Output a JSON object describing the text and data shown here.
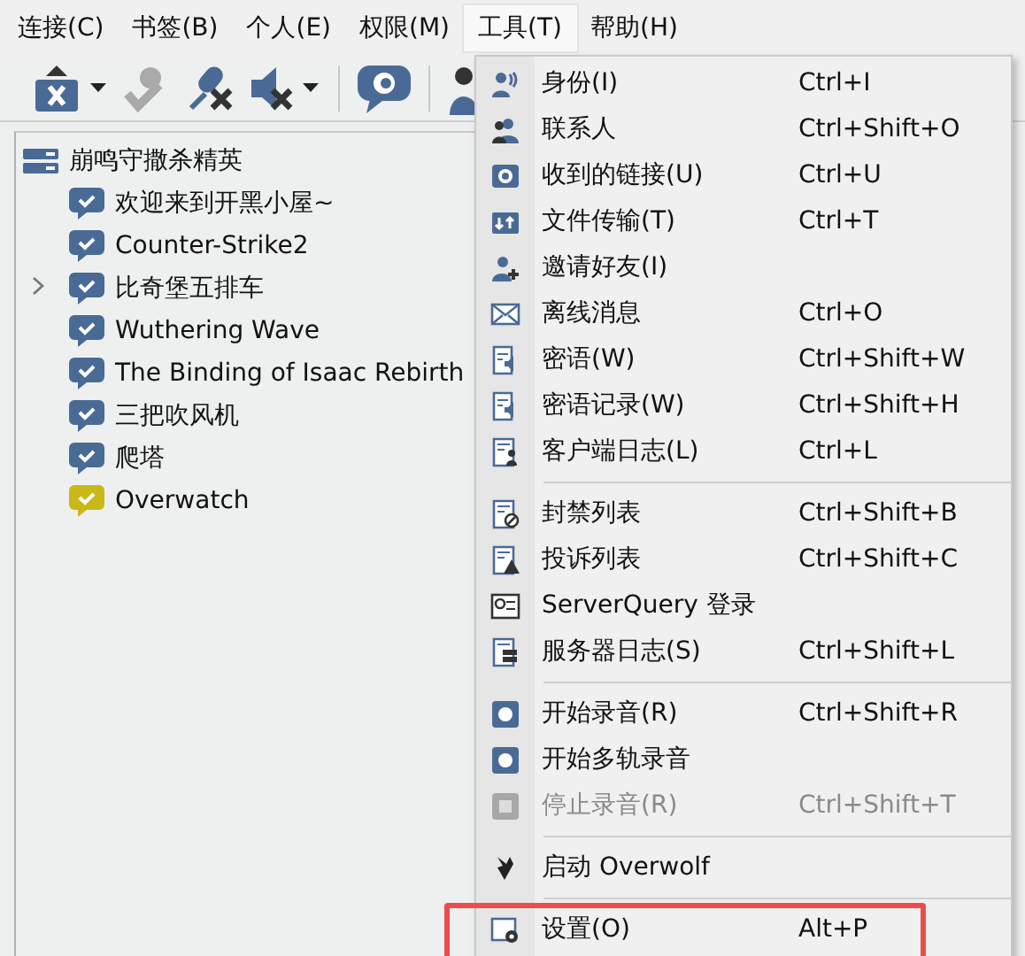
{
  "menubar": [
    {
      "label": "连接(C)",
      "selected": false
    },
    {
      "label": "书签(B)",
      "selected": false
    },
    {
      "label": "个人(E)",
      "selected": false
    },
    {
      "label": "权限(M)",
      "selected": false
    },
    {
      "label": "工具(T)",
      "selected": true
    },
    {
      "label": "帮助(H)",
      "selected": false
    }
  ],
  "tree": {
    "server": "崩鸣守撒杀精英",
    "channels": [
      {
        "name": "欢迎来到开黑小屋~",
        "color": "#4a6a96",
        "expandable": false
      },
      {
        "name": "Counter-Strike2",
        "color": "#4a6a96",
        "expandable": false
      },
      {
        "name": "比奇堡五排车",
        "color": "#4a6a96",
        "expandable": true
      },
      {
        "name": "Wuthering Wave",
        "color": "#4a6a96",
        "expandable": false
      },
      {
        "name": "The Binding of Isaac Rebirth",
        "color": "#4a6a96",
        "expandable": false
      },
      {
        "name": "三把吹风机",
        "color": "#4a6a96",
        "expandable": false
      },
      {
        "name": "爬塔",
        "color": "#4a6a96",
        "expandable": false
      },
      {
        "name": "Overwatch",
        "color": "#c9b817",
        "expandable": false
      }
    ]
  },
  "tools_menu": [
    {
      "kind": "item",
      "label": "身份(I)",
      "shortcut": "Ctrl+I",
      "disabled": false,
      "marked": false
    },
    {
      "kind": "item",
      "label": "联系人",
      "shortcut": "Ctrl+Shift+O",
      "disabled": false,
      "marked": false
    },
    {
      "kind": "item",
      "label": "收到的链接(U)",
      "shortcut": "Ctrl+U",
      "disabled": false,
      "marked": false
    },
    {
      "kind": "item",
      "label": "文件传输(T)",
      "shortcut": "Ctrl+T",
      "disabled": false,
      "marked": false
    },
    {
      "kind": "item",
      "label": "邀请好友(I)",
      "disabled": false,
      "marked": false
    },
    {
      "kind": "item",
      "label": "离线消息",
      "shortcut": "Ctrl+O",
      "disabled": false,
      "marked": false
    },
    {
      "kind": "item",
      "label": "密语(W)",
      "shortcut": "Ctrl+Shift+W",
      "disabled": false,
      "marked": false
    },
    {
      "kind": "item",
      "label": "密语记录(W)",
      "shortcut": "Ctrl+Shift+H",
      "disabled": false,
      "marked": false
    },
    {
      "kind": "item",
      "label": "客户端日志(L)",
      "shortcut": "Ctrl+L",
      "disabled": false,
      "marked": false
    },
    {
      "kind": "separator"
    },
    {
      "kind": "item",
      "label": "封禁列表",
      "shortcut": "Ctrl+Shift+B",
      "disabled": false,
      "marked": false
    },
    {
      "kind": "item",
      "label": "投诉列表",
      "shortcut": "Ctrl+Shift+C",
      "disabled": false,
      "marked": false
    },
    {
      "kind": "item",
      "label": "ServerQuery 登录",
      "disabled": false,
      "marked": false
    },
    {
      "kind": "item",
      "label": "服务器日志(S)",
      "shortcut": "Ctrl+Shift+L",
      "disabled": false,
      "marked": false
    },
    {
      "kind": "separator"
    },
    {
      "kind": "item",
      "label": "开始录音(R)",
      "shortcut": "Ctrl+Shift+R",
      "disabled": false,
      "marked": false
    },
    {
      "kind": "item",
      "label": "开始多轨录音",
      "disabled": false,
      "marked": false
    },
    {
      "kind": "item",
      "label": "停止录音(R)",
      "shortcut": "Ctrl+Shift+T",
      "disabled": true,
      "marked": false
    },
    {
      "kind": "separator"
    },
    {
      "kind": "item",
      "label": "启动 Overwolf",
      "disabled": false,
      "marked": false
    },
    {
      "kind": "separator"
    },
    {
      "kind": "item",
      "label": "设置(O)",
      "shortcut": "Alt+P",
      "disabled": false,
      "marked": true
    }
  ]
}
